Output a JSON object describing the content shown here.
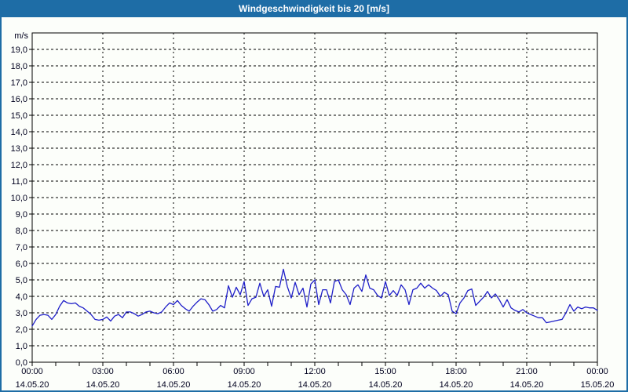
{
  "window": {
    "title": "Windgeschwindigkeit bis 20 [m/s]"
  },
  "colors": {
    "titlebar": "#1e6da6",
    "window_border": "#1e6da6",
    "plot_background": "#fcfefa",
    "axis": "#000000",
    "grid": "#000000",
    "label_text": "#00001e",
    "line": "#1e1ec8"
  },
  "chart_data": {
    "type": "line",
    "title": "Windgeschwindigkeit bis 20 [m/s]",
    "unit_label": "m/s",
    "ylim": [
      0,
      20
    ],
    "ytick_step": 1,
    "ytick_labels": [
      "0,0",
      "1,0",
      "2,0",
      "3,0",
      "4,0",
      "5,0",
      "6,0",
      "7,0",
      "8,0",
      "9,0",
      "10,0",
      "11,0",
      "12,0",
      "13,0",
      "14,0",
      "15,0",
      "16,0",
      "17,0",
      "18,0",
      "19,0"
    ],
    "x_hours_range": [
      0,
      24
    ],
    "x_minor_tick_hours": 1,
    "grid_style": "dashed",
    "xticks": [
      {
        "hour": 0,
        "time": "00:00",
        "date": "14.05.20"
      },
      {
        "hour": 3,
        "time": "03:00",
        "date": "14.05.20"
      },
      {
        "hour": 6,
        "time": "06:00",
        "date": "14.05.20"
      },
      {
        "hour": 9,
        "time": "09:00",
        "date": "14.05.20"
      },
      {
        "hour": 12,
        "time": "12:00",
        "date": "14.05.20"
      },
      {
        "hour": 15,
        "time": "15:00",
        "date": "14.05.20"
      },
      {
        "hour": 18,
        "time": "18:00",
        "date": "14.05.20"
      },
      {
        "hour": 21,
        "time": "21:00",
        "date": "14.05.20"
      },
      {
        "hour": 24,
        "time": "00:00",
        "date": "15.05.20"
      }
    ],
    "series": [
      {
        "name": "Windgeschwindigkeit",
        "color": "#1e1ec8",
        "x_start_minutes": 0,
        "x_step_minutes": 10,
        "values": [
          2.2,
          2.6,
          2.85,
          2.9,
          2.85,
          2.6,
          2.9,
          3.4,
          3.75,
          3.6,
          3.55,
          3.6,
          3.4,
          3.3,
          3.1,
          2.9,
          2.6,
          2.55,
          2.6,
          2.75,
          2.5,
          2.8,
          2.9,
          2.7,
          3.05,
          3.05,
          2.95,
          2.8,
          2.9,
          3.05,
          3.1,
          3.0,
          2.95,
          3.05,
          3.35,
          3.6,
          3.5,
          3.75,
          3.45,
          3.25,
          3.1,
          3.4,
          3.65,
          3.85,
          3.8,
          3.5,
          3.1,
          3.2,
          3.45,
          3.3,
          4.65,
          3.95,
          4.55,
          4.1,
          4.9,
          3.45,
          3.85,
          3.95,
          4.8,
          4.0,
          4.4,
          3.4,
          4.6,
          4.55,
          5.65,
          4.6,
          3.9,
          4.85,
          4.1,
          4.5,
          3.35,
          4.75,
          5.0,
          3.5,
          4.4,
          4.4,
          3.6,
          4.9,
          5.0,
          4.4,
          4.1,
          3.5,
          4.5,
          4.7,
          4.3,
          5.3,
          4.5,
          4.4,
          4.05,
          3.9,
          4.9,
          4.05,
          4.35,
          4.05,
          4.7,
          4.4,
          3.5,
          4.4,
          4.5,
          4.8,
          4.5,
          4.7,
          4.5,
          4.35,
          4.0,
          4.25,
          4.1,
          3.1,
          2.95,
          3.6,
          3.9,
          4.35,
          4.45,
          3.45,
          3.7,
          3.95,
          4.3,
          3.9,
          4.15,
          3.8,
          3.35,
          3.8,
          3.3,
          3.15,
          3.05,
          3.2,
          3.0,
          2.9,
          2.8,
          2.7,
          2.7,
          2.4,
          2.45,
          2.5,
          2.55,
          2.6,
          3.0,
          3.5,
          3.1,
          3.35,
          3.25,
          3.35,
          3.3,
          3.3,
          3.15
        ]
      }
    ]
  }
}
